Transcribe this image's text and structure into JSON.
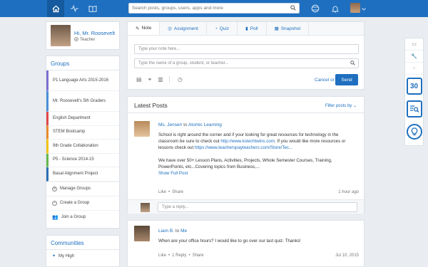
{
  "topbar": {
    "search_placeholder": "Search posts, groups, users, apps and more"
  },
  "profile": {
    "greeting": "Hi, Mr. Roosevelt",
    "role": "Teacher"
  },
  "groups": {
    "title": "Groups",
    "items": [
      {
        "label": "P1 Language Arts 2015-2016",
        "color": "#7a6fd1"
      },
      {
        "label": "Mr. Roosevelt's 5th Graders",
        "color": "#4a90d9"
      },
      {
        "label": "English Department",
        "color": "#e04848"
      },
      {
        "label": "STEM Bootcamp",
        "color": "#e98b2e"
      },
      {
        "label": "9th Grade Collaboration",
        "color": "#f2c316"
      },
      {
        "label": "P5 - Science 2014-15",
        "color": "#62b84e"
      },
      {
        "label": "Basal Alignment Project",
        "color": "#2a6fb5"
      }
    ],
    "actions": {
      "manage": "Manage Groups",
      "create": "Create a Group",
      "join": "Join a Group"
    }
  },
  "communities": {
    "title": "Communities",
    "item": "My High"
  },
  "composer": {
    "tabs": [
      "Note",
      "Assignment",
      "Quiz",
      "Poll",
      "Snapshot"
    ],
    "note_placeholder": "Type your note here...",
    "to_placeholder": "Type the name of a group, student, or teacher...",
    "cancel": "Cancel or",
    "send": "Send"
  },
  "feed": {
    "title": "Latest Posts",
    "filter": "Filter posts by",
    "post1": {
      "author": "Ms. Jensen",
      "to": "to",
      "target": "Atomic Learning",
      "line1": "School is right around the corner and if your looking for great resources for technology in the",
      "line2a": "classroom be sure to check out",
      "link1": "http://www.kstechtwins.com",
      "line2b": ". If you would like more resources or",
      "line3a": "lessons check out",
      "link2": "https://www.teacherspayteachers.com/Store/Tec...",
      "line4": "We have over 50+ Lesson Plans, Activities, Projects, Whole Semester Courses, Training,",
      "line5": "PowerPoints, etc...Covering topics from Business,...",
      "show_full": "Show Full Post",
      "like": "Like",
      "share": "Share",
      "sep": "•",
      "time": "1 hour ago",
      "reply_placeholder": "Type a reply..."
    },
    "post2": {
      "author": "Liam B.",
      "to": "to",
      "target": "Me",
      "body": "When are your office hours? I would like to go over our last quiz. Thanks!",
      "like": "Like",
      "reply": "1 Reply",
      "share": "Share",
      "sep": "•",
      "date": "Jul 10, 2015"
    }
  },
  "rail": {
    "calendar_number": "30"
  }
}
